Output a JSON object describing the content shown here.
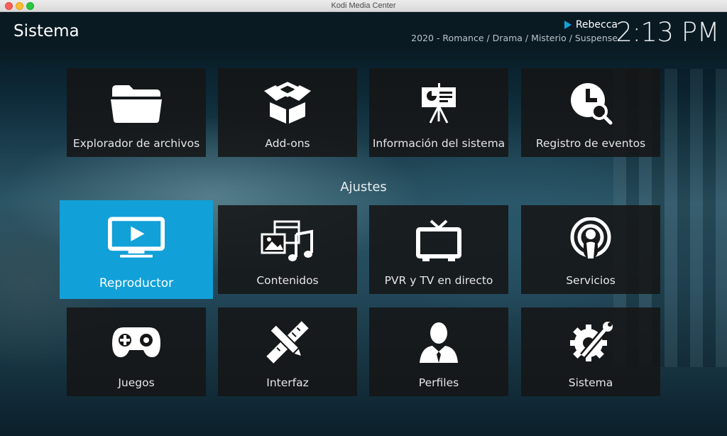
{
  "window": {
    "title": "Kodi Media Center"
  },
  "header": {
    "page_title": "Sistema",
    "now_playing": {
      "title": "Rebecca",
      "genres": "2020 - Romance / Drama / Misterio / Suspense"
    },
    "clock": "2:13 PM"
  },
  "top_row": [
    {
      "label": "Explorador de archivos",
      "icon": "folder-icon"
    },
    {
      "label": "Add-ons",
      "icon": "open-box-icon"
    },
    {
      "label": "Información del sistema",
      "icon": "presentation-easel-icon"
    },
    {
      "label": "Registro de eventos",
      "icon": "clock-search-icon"
    }
  ],
  "section": {
    "label": "Ajustes"
  },
  "settings_row_1": [
    {
      "label": "Reproductor",
      "icon": "monitor-play-icon",
      "focused": true
    },
    {
      "label": "Contenidos",
      "icon": "media-library-icon"
    },
    {
      "label": "PVR y TV en directo",
      "icon": "tv-antenna-icon"
    },
    {
      "label": "Servicios",
      "icon": "podcast-broadcast-icon"
    }
  ],
  "settings_row_2": [
    {
      "label": "Juegos",
      "icon": "gamepad-icon"
    },
    {
      "label": "Interfaz",
      "icon": "pencil-ruler-icon"
    },
    {
      "label": "Perfiles",
      "icon": "user-profile-icon"
    },
    {
      "label": "Sistema",
      "icon": "gear-wrench-icon"
    }
  ],
  "colors": {
    "accent": "#12a0d8",
    "tile_bg": "#161616",
    "text": "#e6e6e6"
  }
}
